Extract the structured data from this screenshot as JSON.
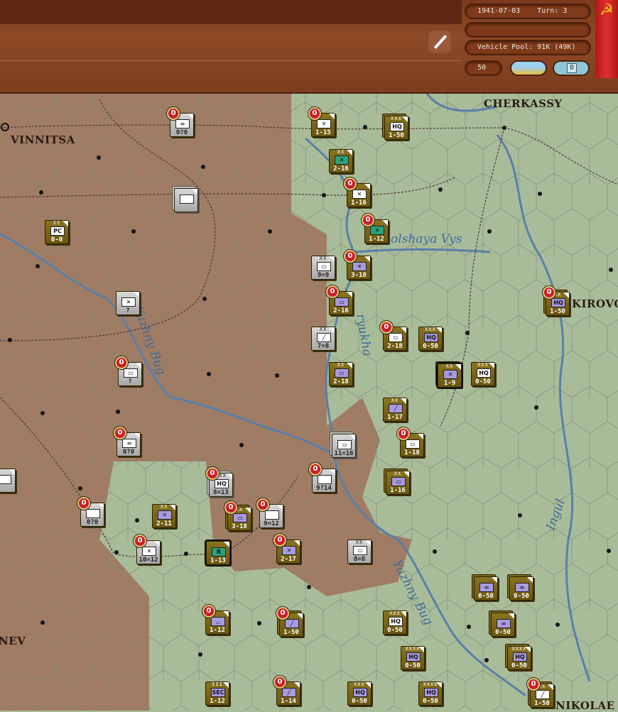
{
  "header": {
    "date": "1941-07-03",
    "turn_label": "Turn: 3",
    "empty_field": "",
    "vehicle_pool": "Vehicle Pool: 91K (49K)",
    "value_field": "50",
    "zoom_button": "0",
    "flag_icon": "hammer-sickle-icon",
    "edit_icon": "pencil-icon"
  },
  "colors": {
    "soviet_counter": "#7a6618",
    "axis_counter": "#c0c0c0",
    "infantry_soviet": "#ffffff",
    "infantry_guard": "#2aa37a",
    "mech": "#a89ae0",
    "map_green": "#a9bc9a",
    "map_brown": "#a07860",
    "river": "#5a7fa8"
  },
  "cities": [
    "VINNITSA",
    "CHERKASSY",
    "KIROVO",
    "NEV",
    "NIKOLAE"
  ],
  "rivers": [
    "olshaya Vys",
    "Yuzhny Bug",
    "ryukha",
    "Yuzhny Bug",
    "Ingul"
  ],
  "units": [
    {
      "side": "grey",
      "size": "",
      "sym": "∞",
      "label": "0?0",
      "badge": "0"
    },
    {
      "side": "grey",
      "size": "",
      "sym": "",
      "label": "",
      "stack": true
    },
    {
      "side": "olive",
      "size": "II",
      "sym": "PC",
      "label": "0-0"
    },
    {
      "side": "grey",
      "size": "",
      "sym": "✕",
      "label": "?"
    },
    {
      "side": "grey",
      "size": "",
      "sym": "▭",
      "label": "?",
      "badge": "0"
    },
    {
      "side": "grey",
      "size": "",
      "sym": "∞",
      "label": "0?0",
      "badge": "0"
    },
    {
      "side": "grey",
      "size": "",
      "sym": "",
      "label": "0?0",
      "badge": "0"
    },
    {
      "side": "grey",
      "size": "",
      "sym": "✕",
      "label": "10=12",
      "badge": "0"
    },
    {
      "side": "olive",
      "size": "",
      "sym": "✕",
      "label": "1-15",
      "badge": "0"
    },
    {
      "side": "olive",
      "size": "XXX",
      "sym": "HQ",
      "label": "1-50",
      "stack": true
    },
    {
      "side": "olive",
      "size": "XX",
      "sym": "✕",
      "symColor": "#2aa37a",
      "label": "2-16"
    },
    {
      "side": "olive",
      "size": "",
      "sym": "✕",
      "label": "1-16",
      "badge": "0"
    },
    {
      "side": "olive",
      "size": "",
      "sym": "✕",
      "symColor": "#2aa37a",
      "label": "1-12",
      "badge": "0"
    },
    {
      "side": "grey",
      "size": "XX",
      "sym": "▭",
      "label": "9=9"
    },
    {
      "side": "olive",
      "size": "",
      "sym": "✕",
      "symColor": "#a89ae0",
      "label": "3-18",
      "badge": "0"
    },
    {
      "side": "olive",
      "size": "",
      "sym": "▭",
      "symColor": "#a89ae0",
      "label": "2-16",
      "badge": "0"
    },
    {
      "side": "grey",
      "size": "XX",
      "sym": "╱",
      "label": "7=8"
    },
    {
      "side": "olive",
      "size": "",
      "sym": "▭",
      "label": "2-18",
      "badge": "0"
    },
    {
      "side": "olive",
      "size": "XXX",
      "sym": "HQ",
      "symColor": "#a89ae0",
      "label": "0-50"
    },
    {
      "side": "olive",
      "size": "XX",
      "sym": "▭",
      "symColor": "#a89ae0",
      "label": "2-18"
    },
    {
      "side": "olive",
      "size": "XX",
      "sym": "✕",
      "symColor": "#a89ae0",
      "label": "1-9",
      "stack": true,
      "sel": true
    },
    {
      "side": "olive",
      "size": "XXX",
      "sym": "HQ",
      "label": "0-50"
    },
    {
      "side": "olive",
      "size": "XX",
      "sym": "╱",
      "symColor": "#a89ae0",
      "label": "1-17"
    },
    {
      "side": "grey",
      "size": "",
      "sym": "▭",
      "label": "11=16",
      "stack": true
    },
    {
      "side": "olive",
      "size": "",
      "sym": "▭",
      "label": "1-18",
      "badge": "0"
    },
    {
      "side": "grey",
      "size": "",
      "sym": "",
      "label": "9?14",
      "badge": "0"
    },
    {
      "side": "grey",
      "size": "XXX",
      "sym": "HQ",
      "label": "8=13",
      "badge": "0",
      "stack": true
    },
    {
      "side": "olive",
      "size": "XX",
      "sym": "▭",
      "symColor": "#a89ae0",
      "label": "1-16",
      "stack": true
    },
    {
      "side": "olive",
      "size": "XX",
      "sym": "✕",
      "symColor": "#a89ae0",
      "label": "2-11"
    },
    {
      "side": "olive",
      "size": "XX",
      "sym": "▭",
      "symColor": "#a89ae0",
      "label": "3-18",
      "badge": "0",
      "stack": true
    },
    {
      "side": "grey",
      "size": "",
      "sym": "",
      "label": "9=12",
      "badge": "0"
    },
    {
      "side": "olive",
      "size": "",
      "sym": "R",
      "symColor": "#2aa37a",
      "label": "1-13",
      "sel": true
    },
    {
      "side": "olive",
      "size": "",
      "sym": "✕",
      "symColor": "#a89ae0",
      "label": "2-17",
      "badge": "0"
    },
    {
      "side": "grey",
      "size": "XX",
      "sym": "▭",
      "label": "8=8"
    },
    {
      "side": "olive",
      "size": "",
      "sym": "∞",
      "symColor": "#a89ae0",
      "label": "0-50",
      "stack": true
    },
    {
      "side": "olive",
      "size": "",
      "sym": "∞",
      "symColor": "#a89ae0",
      "label": "0-50",
      "stack": true
    },
    {
      "side": "olive",
      "size": "",
      "sym": "◡",
      "symColor": "#a89ae0",
      "label": "1-12",
      "badge": "0"
    },
    {
      "side": "olive",
      "size": "",
      "sym": "╱",
      "symColor": "#a89ae0",
      "label": "1-50",
      "badge": "0",
      "stack": true
    },
    {
      "side": "olive",
      "size": "XXX",
      "sym": "HQ",
      "label": "0-50"
    },
    {
      "side": "olive",
      "size": "",
      "sym": "∞",
      "symColor": "#a89ae0",
      "label": "0-50",
      "stack": true
    },
    {
      "side": "olive",
      "size": "XXXX",
      "sym": "HQ",
      "symColor": "#a89ae0",
      "label": "0-50"
    },
    {
      "side": "olive",
      "size": "XXXX",
      "sym": "HQ",
      "symColor": "#a89ae0",
      "label": "0-50",
      "stack": true
    },
    {
      "side": "olive",
      "size": "III",
      "sym": "SEC",
      "symColor": "#a89ae0",
      "label": "1-12"
    },
    {
      "side": "olive",
      "size": "",
      "sym": "╱",
      "symColor": "#a89ae0",
      "label": "1-14",
      "badge": "0"
    },
    {
      "side": "olive",
      "size": "XXX",
      "sym": "HQ",
      "symColor": "#a89ae0",
      "label": "0-50"
    },
    {
      "side": "olive",
      "size": "XXXX",
      "sym": "HQ",
      "symColor": "#a89ae0",
      "label": "0-50"
    },
    {
      "side": "olive",
      "size": "XX",
      "sym": "HQ",
      "symColor": "#a89ae0",
      "label": "1-50",
      "badge": "0",
      "stack": true
    },
    {
      "side": "olive",
      "size": "XX",
      "sym": "╱",
      "label": "1-50",
      "badge": "0",
      "stack": true
    },
    {
      "side": "grey",
      "size": "",
      "sym": "",
      "label": ""
    }
  ]
}
